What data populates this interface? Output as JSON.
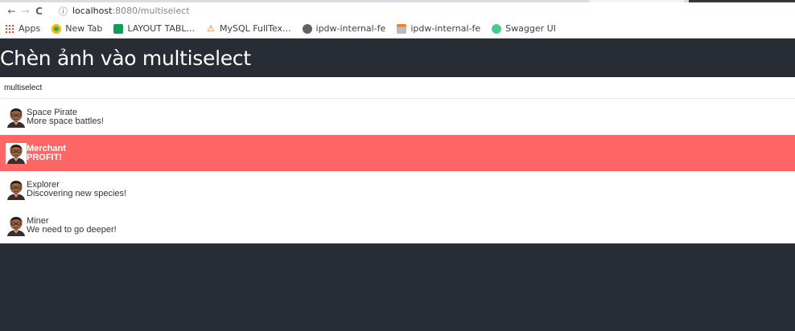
{
  "browser": {
    "url_host": "localhost",
    "url_path": ":8080/multiselect",
    "bookmarks": [
      {
        "label": "Apps",
        "icon": "apps-grid-icon"
      },
      {
        "label": "New Tab",
        "icon": "chrome-icon"
      },
      {
        "label": "LAYOUT TABL...",
        "icon": "sheets-icon"
      },
      {
        "label": "MySQL FullTex...",
        "icon": "mysql-icon"
      },
      {
        "label": "ipdw-internal-fe",
        "icon": "globe-icon"
      },
      {
        "label": "ipdw-internal-fe",
        "icon": "stackoverflow-icon"
      },
      {
        "label": "Swagger UI",
        "icon": "swagger-icon"
      }
    ]
  },
  "header": {
    "title": "Chèn ảnh vào multiselect"
  },
  "select": {
    "search_value": "multiselect",
    "options": [
      {
        "title": "Space Pirate",
        "desc": "More space battles!",
        "selected": false
      },
      {
        "title": "Merchant",
        "desc": "PROFIT!",
        "selected": true
      },
      {
        "title": "Explorer",
        "desc": "Discovering new species!",
        "selected": false
      },
      {
        "title": "Miner",
        "desc": "We need to go deeper!",
        "selected": false
      }
    ]
  },
  "colors": {
    "app_bg": "#282c34",
    "highlight": "#ff6666"
  }
}
